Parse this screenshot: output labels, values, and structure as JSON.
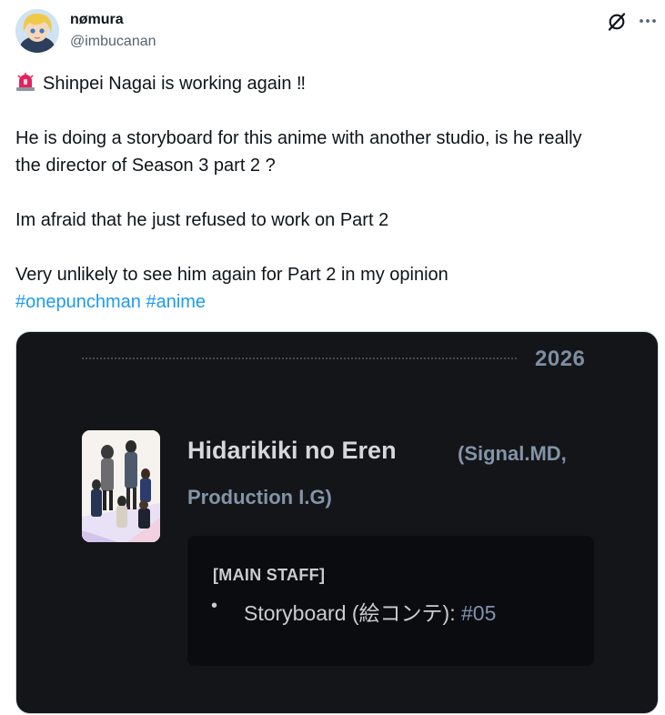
{
  "author": {
    "display_name": "nømura",
    "handle": "@imbucanan",
    "avatar_icon": "anime-character-avatar"
  },
  "header_icons": [
    "grok-icon",
    "more-options-icon"
  ],
  "tweet": {
    "lines": [
      "Shinpei Nagai is working again ‼",
      "He is doing a storyboard for this anime with another studio, is he really",
      "the director of Season 3 part 2 ?",
      "Im afraid that he just refused to work on Part 2",
      "Very unlikely to see him again for Part 2 in my opinion"
    ],
    "emoji": "police-siren",
    "hashtags": [
      "#onepunchman",
      "#anime"
    ]
  },
  "media": {
    "year": "2026",
    "anime_title": "Hidarikiki no Eren",
    "studio_line_1": "(Signal.MD,",
    "studio_line_2": "Production I.G)",
    "staff_heading": "[MAIN STAFF]",
    "staff_bullet": "•",
    "staff_role": "Storyboard (絵コンテ): ",
    "staff_episode": "#05"
  },
  "colors": {
    "hashtag": "#1d9bf0",
    "card_background": "#141518",
    "staff_box": "#0b0c0f",
    "muted_blue": "#8394a8"
  }
}
